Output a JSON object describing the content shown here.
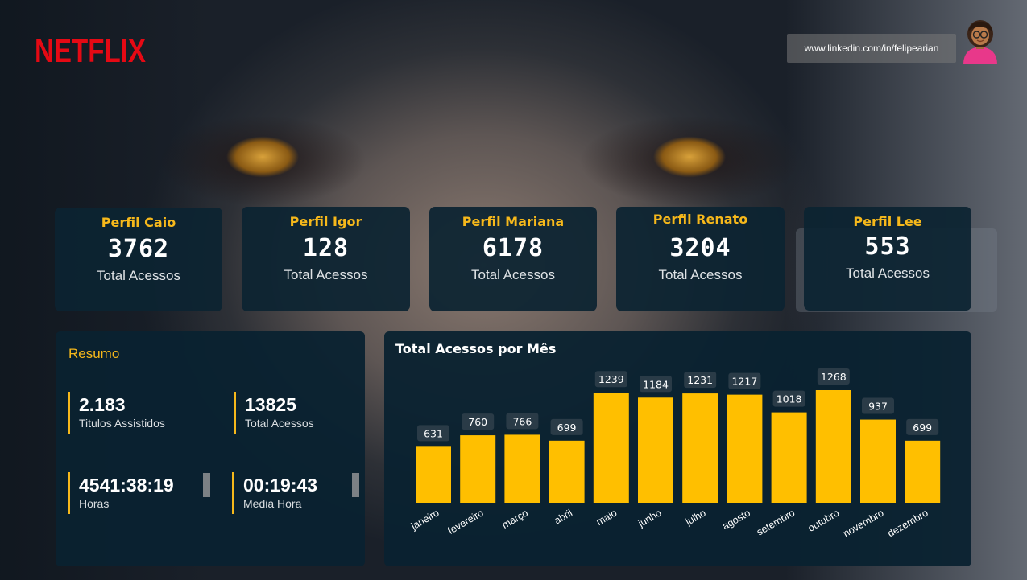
{
  "brand": {
    "logo_text": "NETFLIX",
    "logo_color": "#e50914"
  },
  "header": {
    "linkedin_url": "www.linkedin.com/in/felipearian"
  },
  "kpis": [
    {
      "name": "Perfil Caio",
      "value": "3762",
      "label": "Total Acessos"
    },
    {
      "name": "Perfil Igor",
      "value": "128",
      "label": "Total Acessos"
    },
    {
      "name": "Perfil Mariana",
      "value": "6178",
      "label": "Total Acessos"
    },
    {
      "name": "Perfil Renato",
      "value": "3204",
      "label": "Total Acessos"
    },
    {
      "name": "Perfil Lee",
      "value": "553",
      "label": "Total Acessos"
    }
  ],
  "resumo": {
    "title": "Resumo",
    "stats": [
      {
        "value": "2.183",
        "label": "Titulos Assistidos"
      },
      {
        "value": "13825",
        "label": "Total Acessos"
      },
      {
        "value": "4541:38:19",
        "label": "Horas"
      },
      {
        "value": "00:19:43",
        "label": "Media Hora"
      }
    ]
  },
  "colors": {
    "accent": "#f6b81b",
    "bar": "#ffbf00",
    "panel": "#0a2230"
  },
  "chart_data": {
    "type": "bar",
    "title": "Total Acessos por Mês",
    "categories": [
      "janeiro",
      "fevereiro",
      "março",
      "abril",
      "maio",
      "junho",
      "julho",
      "agosto",
      "setembro",
      "outubro",
      "novembro",
      "dezembro"
    ],
    "values": [
      631,
      760,
      766,
      699,
      1239,
      1184,
      1231,
      1217,
      1018,
      1268,
      937,
      699
    ],
    "xlabel": "",
    "ylabel": "",
    "grid": false,
    "legend": "none"
  }
}
